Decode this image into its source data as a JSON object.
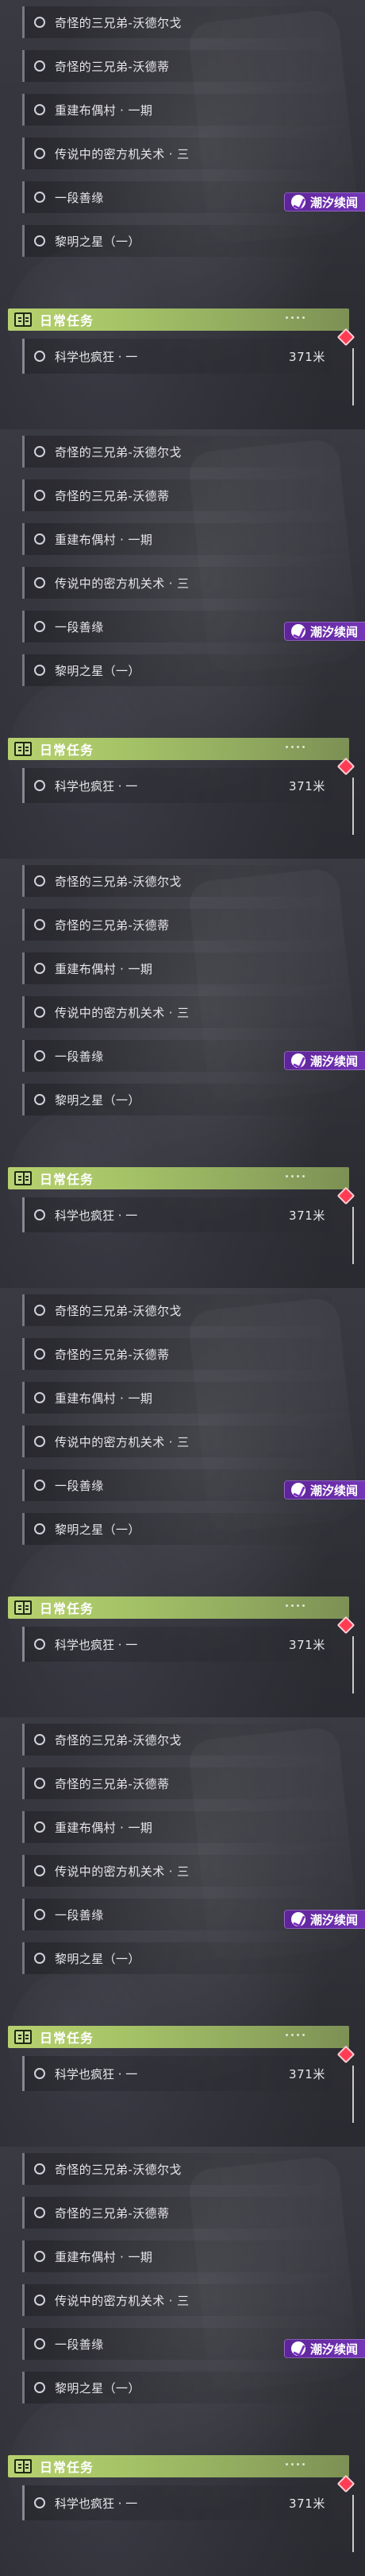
{
  "screens": [
    {
      "quests": [
        "奇怪的三兄弟-沃德尔戈",
        "奇怪的三兄弟-沃德蒂",
        "重建布偶村 · 一期",
        "传说中的密方机关术 · 三",
        "一段善缘",
        "黎明之星（一）"
      ],
      "badge": "潮汐续闻",
      "daily_title": "日常任务",
      "daily_task": "科学也疯狂 · 一",
      "distance": "371米"
    },
    {
      "quests": [
        "奇怪的三兄弟-沃德尔戈",
        "奇怪的三兄弟-沃德蒂",
        "重建布偶村 · 一期",
        "传说中的密方机关术 · 三",
        "一段善缘",
        "黎明之星（一）"
      ],
      "badge": "潮汐续闻",
      "daily_title": "日常任务",
      "daily_task": "科学也疯狂 · 一",
      "distance": "371米"
    },
    {
      "quests": [
        "奇怪的三兄弟-沃德尔戈",
        "奇怪的三兄弟-沃德蒂",
        "重建布偶村 · 一期",
        "传说中的密方机关术 · 三",
        "一段善缘",
        "黎明之星（一）"
      ],
      "badge": "潮汐续闻",
      "daily_title": "日常任务",
      "daily_task": "科学也疯狂 · 一",
      "distance": "371米"
    },
    {
      "quests": [
        "奇怪的三兄弟-沃德尔戈",
        "奇怪的三兄弟-沃德蒂",
        "重建布偶村 · 一期",
        "传说中的密方机关术 · 三",
        "一段善缘",
        "黎明之星（一）"
      ],
      "badge": "潮汐续闻",
      "daily_title": "日常任务",
      "daily_task": "科学也疯狂 · 一",
      "distance": "371米"
    },
    {
      "quests": [
        "奇怪的三兄弟-沃德尔戈",
        "奇怪的三兄弟-沃德蒂",
        "重建布偶村 · 一期",
        "传说中的密方机关术 · 三",
        "一段善缘",
        "黎明之星（一）"
      ],
      "badge": "潮汐续闻",
      "daily_title": "日常任务",
      "daily_task": "科学也疯狂 · 一",
      "distance": "371米"
    },
    {
      "quests": [
        "奇怪的三兄弟-沃德尔戈",
        "奇怪的三兄弟-沃德蒂",
        "重建布偶村 · 一期",
        "传说中的密方机关术 · 三",
        "一段善缘",
        "黎明之星（一）"
      ],
      "badge": "潮汐续闻",
      "daily_title": "日常任务",
      "daily_task": "科学也疯狂 · 一",
      "distance": "371米"
    }
  ]
}
